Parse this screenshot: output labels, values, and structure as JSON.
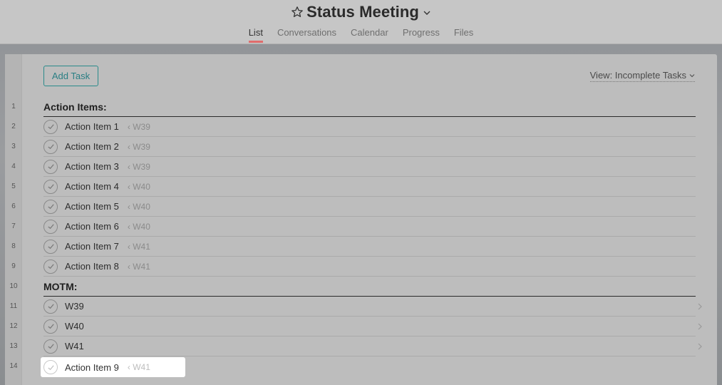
{
  "header": {
    "title": "Status Meeting",
    "tabs": [
      {
        "label": "List",
        "active": true
      },
      {
        "label": "Conversations",
        "active": false
      },
      {
        "label": "Calendar",
        "active": false
      },
      {
        "label": "Progress",
        "active": false
      },
      {
        "label": "Files",
        "active": false
      }
    ]
  },
  "toolbar": {
    "add_task_label": "Add Task",
    "view_label": "View: Incomplete Tasks"
  },
  "line_numbers": [
    "1",
    "2",
    "3",
    "4",
    "5",
    "6",
    "7",
    "8",
    "9",
    "10",
    "11",
    "12",
    "13",
    "14"
  ],
  "rows": [
    {
      "type": "section",
      "label": "Action Items:"
    },
    {
      "type": "task",
      "label": "Action Item 1",
      "parent": "‹ W39"
    },
    {
      "type": "task",
      "label": "Action Item 2",
      "parent": "‹ W39"
    },
    {
      "type": "task",
      "label": "Action Item 3",
      "parent": "‹ W39"
    },
    {
      "type": "task",
      "label": "Action Item 4",
      "parent": "‹ W40"
    },
    {
      "type": "task",
      "label": "Action Item 5",
      "parent": "‹ W40"
    },
    {
      "type": "task",
      "label": "Action Item 6",
      "parent": "‹ W40"
    },
    {
      "type": "task",
      "label": "Action Item 7",
      "parent": "‹ W41"
    },
    {
      "type": "task",
      "label": "Action Item 8",
      "parent": "‹ W41"
    },
    {
      "type": "section",
      "label": "MOTM:"
    },
    {
      "type": "task",
      "label": "W39",
      "parent": "",
      "chevron": true
    },
    {
      "type": "task",
      "label": "W40",
      "parent": "",
      "chevron": true
    },
    {
      "type": "task",
      "label": "W41",
      "parent": "",
      "chevron": true
    },
    {
      "type": "task",
      "label": "Action Item 9",
      "parent": "‹ W41",
      "highlighted": true
    }
  ],
  "colors": {
    "accent": "#2a8b8b",
    "active_tab_underline": "#e06c6c"
  }
}
